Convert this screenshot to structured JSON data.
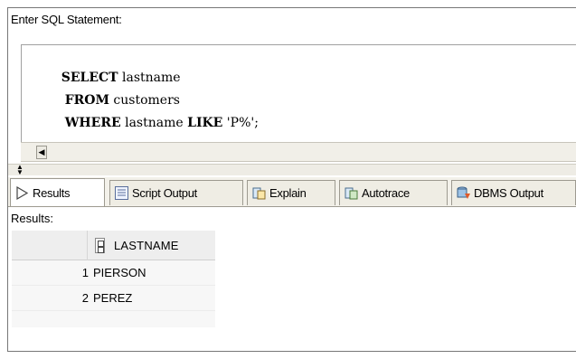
{
  "editor": {
    "label": "Enter SQL Statement:",
    "lines": [
      {
        "kw": "SELECT",
        "rest": " lastname"
      },
      {
        "kw": "FROM",
        "rest": " customers"
      },
      {
        "kw": "WHERE",
        "rest": " lastname ",
        "kw2": "LIKE",
        "rest2": " 'P%';"
      }
    ]
  },
  "tabs": [
    {
      "label": "Results",
      "icon": "play-icon"
    },
    {
      "label": "Script Output",
      "icon": "script-icon"
    },
    {
      "label": "Explain",
      "icon": "explain-icon"
    },
    {
      "label": "Autotrace",
      "icon": "autotrace-icon"
    },
    {
      "label": "DBMS Output",
      "icon": "dbms-output-icon"
    }
  ],
  "results": {
    "label": "Results:",
    "columns": [
      "LASTNAME"
    ],
    "rows": [
      {
        "num": "1",
        "lastname": "PIERSON"
      },
      {
        "num": "2",
        "lastname": "PEREZ"
      }
    ]
  },
  "colors": {
    "tab_bg": "#efede4",
    "grid_bg": "#f7f7f7"
  }
}
